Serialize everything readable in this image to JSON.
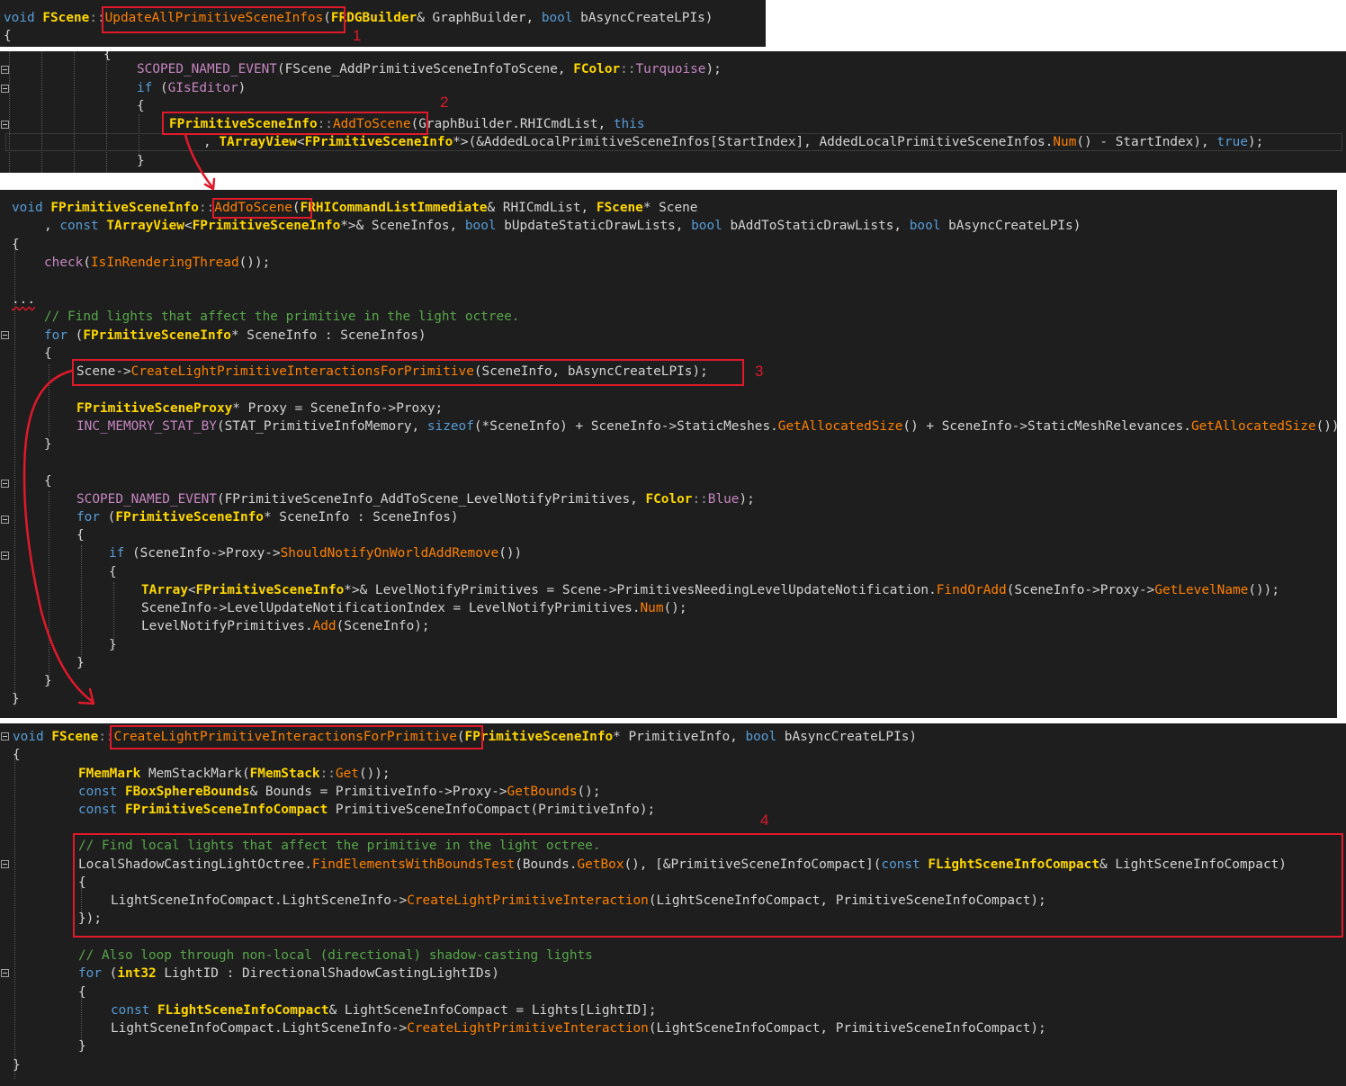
{
  "panel1": {
    "lines": [
      {
        "parts": [
          [
            "kw",
            "void "
          ],
          [
            "ty",
            "FScene"
          ],
          [
            "pm",
            "::"
          ],
          [
            "fn",
            "UpdateAllPrimitiveSceneInfos"
          ],
          [
            "lv",
            "("
          ],
          [
            "ty",
            "FRDGBuilder"
          ],
          [
            "lv",
            "& GraphBuilder, "
          ],
          [
            "kw",
            "bool "
          ],
          [
            "lv",
            "bAsyncCreateLPIs)"
          ]
        ]
      },
      {
        "parts": [
          [
            "lv",
            "{"
          ]
        ]
      }
    ]
  },
  "panel2": {
    "lines": [
      {
        "parts": [
          [
            "lv",
            "{"
          ]
        ]
      },
      {
        "parts": [
          [
            "mc",
            "SCOPED_NAMED_EVENT"
          ],
          [
            "lv",
            "(FScene_AddPrimitiveSceneInfoToScene, "
          ],
          [
            "ty",
            "FColor"
          ],
          [
            "pm",
            "::"
          ],
          [
            "mc",
            "Turquoise"
          ],
          [
            "lv",
            ");"
          ]
        ]
      },
      {
        "parts": [
          [
            "kw",
            "if "
          ],
          [
            "lv",
            "("
          ],
          [
            "mc",
            "GIsEditor"
          ],
          [
            "lv",
            ")"
          ]
        ]
      },
      {
        "parts": [
          [
            "lv",
            "{"
          ]
        ]
      },
      {
        "parts": [
          [
            "ty",
            "FPrimitiveSceneInfo"
          ],
          [
            "pm",
            "::"
          ],
          [
            "fn",
            "AddToScene"
          ],
          [
            "lv",
            "(GraphBuilder.RHICmdList, "
          ],
          [
            "kw",
            "this"
          ]
        ]
      },
      {
        "parts": [
          [
            "lv",
            ", "
          ],
          [
            "ty",
            "TArrayView"
          ],
          [
            "lv",
            "<"
          ],
          [
            "ty",
            "FPrimitiveSceneInfo"
          ],
          [
            "lv",
            "*>(&AddedLocalPrimitiveSceneInfos[StartIndex], AddedLocalPrimitiveSceneInfos."
          ],
          [
            "fn",
            "Num"
          ],
          [
            "lv",
            "() - StartIndex), "
          ],
          [
            "kw",
            "true"
          ],
          [
            "lv",
            ");"
          ]
        ]
      },
      {
        "parts": [
          [
            "lv",
            "}"
          ]
        ]
      }
    ]
  },
  "panel3": {
    "lines": [
      {
        "parts": [
          [
            "kw",
            "void "
          ],
          [
            "ty",
            "FPrimitiveSceneInfo"
          ],
          [
            "pm",
            "::"
          ],
          [
            "fn",
            "AddToScene"
          ],
          [
            "lv",
            "("
          ],
          [
            "ty",
            "FRHICommandListImmediate"
          ],
          [
            "lv",
            "& RHICmdList, "
          ],
          [
            "ty",
            "FScene"
          ],
          [
            "lv",
            "* Scene"
          ]
        ]
      },
      {
        "parts": [
          [
            "lv",
            ", "
          ],
          [
            "kw",
            "const "
          ],
          [
            "ty",
            "TArrayView"
          ],
          [
            "lv",
            "<"
          ],
          [
            "ty",
            "FPrimitiveSceneInfo"
          ],
          [
            "lv",
            "*>& SceneInfos, "
          ],
          [
            "kw",
            "bool "
          ],
          [
            "lv",
            "bUpdateStaticDrawLists, "
          ],
          [
            "kw",
            "bool "
          ],
          [
            "lv",
            "bAddToStaticDrawLists, "
          ],
          [
            "kw",
            "bool "
          ],
          [
            "lv",
            "bAsyncCreateLPIs)"
          ]
        ]
      },
      {
        "parts": [
          [
            "lv",
            "{"
          ]
        ]
      },
      {
        "parts": [
          [
            "mc",
            "check"
          ],
          [
            "lv",
            "("
          ],
          [
            "fn",
            "IsInRenderingThread"
          ],
          [
            "lv",
            "());"
          ]
        ]
      },
      {
        "parts": [
          [
            "lv",
            "..."
          ]
        ]
      },
      {
        "parts": [
          [
            "cm",
            "// Find lights that affect the primitive in the light octree."
          ]
        ]
      },
      {
        "parts": [
          [
            "kw",
            "for "
          ],
          [
            "lv",
            "("
          ],
          [
            "ty",
            "FPrimitiveSceneInfo"
          ],
          [
            "lv",
            "* SceneInfo : SceneInfos)"
          ]
        ]
      },
      {
        "parts": [
          [
            "lv",
            "{"
          ]
        ]
      },
      {
        "parts": [
          [
            "lv",
            "Scene->"
          ],
          [
            "fn",
            "CreateLightPrimitiveInteractionsForPrimitive"
          ],
          [
            "lv",
            "(SceneInfo, bAsyncCreateLPIs);"
          ]
        ]
      },
      {
        "parts": [
          [
            "ty",
            "FPrimitiveSceneProxy"
          ],
          [
            "lv",
            "* Proxy = SceneInfo->Proxy;"
          ]
        ]
      },
      {
        "parts": [
          [
            "mc",
            "INC_MEMORY_STAT_BY"
          ],
          [
            "lv",
            "(STAT_PrimitiveInfoMemory, "
          ],
          [
            "kw",
            "sizeof"
          ],
          [
            "lv",
            "(*SceneInfo) + SceneInfo->StaticMeshes."
          ],
          [
            "fn",
            "GetAllocatedSize"
          ],
          [
            "lv",
            "() + SceneInfo->StaticMeshRelevances."
          ],
          [
            "fn",
            "GetAllocatedSize"
          ],
          [
            "lv",
            "());"
          ]
        ]
      },
      {
        "parts": [
          [
            "lv",
            "}"
          ]
        ]
      },
      {
        "parts": [
          [
            "lv",
            "{"
          ]
        ]
      },
      {
        "parts": [
          [
            "mc",
            "SCOPED_NAMED_EVENT"
          ],
          [
            "lv",
            "(FPrimitiveSceneInfo_AddToScene_LevelNotifyPrimitives, "
          ],
          [
            "ty",
            "FColor"
          ],
          [
            "pm",
            "::"
          ],
          [
            "mc",
            "Blue"
          ],
          [
            "lv",
            ");"
          ]
        ]
      },
      {
        "parts": [
          [
            "kw",
            "for "
          ],
          [
            "lv",
            "("
          ],
          [
            "ty",
            "FPrimitiveSceneInfo"
          ],
          [
            "lv",
            "* SceneInfo : SceneInfos)"
          ]
        ]
      },
      {
        "parts": [
          [
            "lv",
            "{"
          ]
        ]
      },
      {
        "parts": [
          [
            "kw",
            "if "
          ],
          [
            "lv",
            "(SceneInfo->Proxy->"
          ],
          [
            "fn",
            "ShouldNotifyOnWorldAddRemove"
          ],
          [
            "lv",
            "())"
          ]
        ]
      },
      {
        "parts": [
          [
            "lv",
            "{"
          ]
        ]
      },
      {
        "parts": [
          [
            "ty",
            "TArray"
          ],
          [
            "lv",
            "<"
          ],
          [
            "ty",
            "FPrimitiveSceneInfo"
          ],
          [
            "lv",
            "*>& LevelNotifyPrimitives = Scene->PrimitivesNeedingLevelUpdateNotification."
          ],
          [
            "fn",
            "FindOrAdd"
          ],
          [
            "lv",
            "(SceneInfo->Proxy->"
          ],
          [
            "fn",
            "GetLevelName"
          ],
          [
            "lv",
            "());"
          ]
        ]
      },
      {
        "parts": [
          [
            "lv",
            "SceneInfo->LevelUpdateNotificationIndex = LevelNotifyPrimitives."
          ],
          [
            "fn",
            "Num"
          ],
          [
            "lv",
            "();"
          ]
        ]
      },
      {
        "parts": [
          [
            "lv",
            "LevelNotifyPrimitives."
          ],
          [
            "fn",
            "Add"
          ],
          [
            "lv",
            "(SceneInfo);"
          ]
        ]
      },
      {
        "parts": [
          [
            "lv",
            "}"
          ]
        ]
      },
      {
        "parts": [
          [
            "lv",
            "}"
          ]
        ]
      },
      {
        "parts": [
          [
            "lv",
            "}"
          ]
        ]
      },
      {
        "parts": [
          [
            "lv",
            "}"
          ]
        ]
      }
    ]
  },
  "panel4": {
    "lines": [
      {
        "parts": [
          [
            "kw",
            "void "
          ],
          [
            "ty",
            "FScene"
          ],
          [
            "pm",
            "::"
          ],
          [
            "fn",
            "CreateLightPrimitiveInteractionsForPrimitive"
          ],
          [
            "lv",
            "("
          ],
          [
            "ty",
            "FPrimitiveSceneInfo"
          ],
          [
            "lv",
            "* PrimitiveInfo, "
          ],
          [
            "kw",
            "bool "
          ],
          [
            "lv",
            "bAsyncCreateLPIs)"
          ]
        ]
      },
      {
        "parts": [
          [
            "lv",
            "{"
          ]
        ]
      },
      {
        "parts": [
          [
            "ty",
            "FMemMark "
          ],
          [
            "lv",
            "MemStackMark("
          ],
          [
            "ty",
            "FMemStack"
          ],
          [
            "pm",
            "::"
          ],
          [
            "fn",
            "Get"
          ],
          [
            "lv",
            "());"
          ]
        ]
      },
      {
        "parts": [
          [
            "kw",
            "const "
          ],
          [
            "ty",
            "FBoxSphereBounds"
          ],
          [
            "lv",
            "& Bounds = PrimitiveInfo->Proxy->"
          ],
          [
            "fn",
            "GetBounds"
          ],
          [
            "lv",
            "();"
          ]
        ]
      },
      {
        "parts": [
          [
            "kw",
            "const "
          ],
          [
            "ty",
            "FPrimitiveSceneInfoCompact "
          ],
          [
            "lv",
            "PrimitiveSceneInfoCompact(PrimitiveInfo);"
          ]
        ]
      },
      {
        "parts": [
          [
            "cm",
            "// Find local lights that affect the primitive in the light octree."
          ]
        ]
      },
      {
        "parts": [
          [
            "lv",
            "LocalShadowCastingLightOctree."
          ],
          [
            "fn",
            "FindElementsWithBoundsTest"
          ],
          [
            "lv",
            "(Bounds."
          ],
          [
            "fn",
            "GetBox"
          ],
          [
            "lv",
            "(), [&PrimitiveSceneInfoCompact]("
          ],
          [
            "kw",
            "const "
          ],
          [
            "ty",
            "FLightSceneInfoCompact"
          ],
          [
            "lv",
            "& LightSceneInfoCompact)"
          ]
        ]
      },
      {
        "parts": [
          [
            "lv",
            "{"
          ]
        ]
      },
      {
        "parts": [
          [
            "lv",
            "LightSceneInfoCompact.LightSceneInfo->"
          ],
          [
            "fn",
            "CreateLightPrimitiveInteraction"
          ],
          [
            "lv",
            "(LightSceneInfoCompact, PrimitiveSceneInfoCompact);"
          ]
        ]
      },
      {
        "parts": [
          [
            "lv",
            "});"
          ]
        ]
      },
      {
        "parts": [
          [
            "cm",
            "// Also loop through non-local (directional) shadow-casting lights"
          ]
        ]
      },
      {
        "parts": [
          [
            "kw",
            "for "
          ],
          [
            "lv",
            "("
          ],
          [
            "ty",
            "int32 "
          ],
          [
            "lv",
            "LightID : DirectionalShadowCastingLightIDs)"
          ]
        ]
      },
      {
        "parts": [
          [
            "lv",
            "{"
          ]
        ]
      },
      {
        "parts": [
          [
            "kw",
            "const "
          ],
          [
            "ty",
            "FLightSceneInfoCompact"
          ],
          [
            "lv",
            "& LightSceneInfoCompact = Lights[LightID];"
          ]
        ]
      },
      {
        "parts": [
          [
            "lv",
            "LightSceneInfoCompact.LightSceneInfo->"
          ],
          [
            "fn",
            "CreateLightPrimitiveInteraction"
          ],
          [
            "lv",
            "(LightSceneInfoCompact, PrimitiveSceneInfoCompact);"
          ]
        ]
      },
      {
        "parts": [
          [
            "lv",
            "}"
          ]
        ]
      },
      {
        "parts": [
          [
            "lv",
            "}"
          ]
        ]
      }
    ]
  },
  "annotations": {
    "n1": "1",
    "n2": "2",
    "n3": "3",
    "n4": "4"
  },
  "colors": {
    "accent": "#e0192b",
    "editor_bg": "#1e1e1e"
  }
}
